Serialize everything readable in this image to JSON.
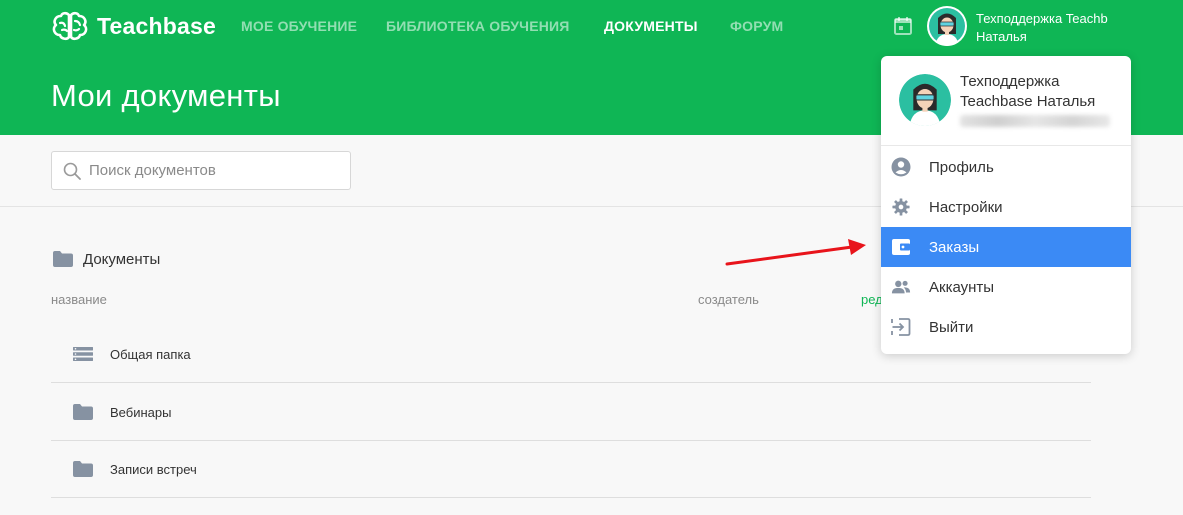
{
  "brand": {
    "name": "Teachbase",
    "primary_color": "#0fb655"
  },
  "nav": {
    "items": [
      {
        "label": "МОЕ ОБУЧЕНИЕ",
        "active": false
      },
      {
        "label": "БИБЛИОТЕКА ОБУЧЕНИЯ",
        "active": false
      },
      {
        "label": "ДОКУМЕНТЫ",
        "active": true
      },
      {
        "label": "ФОРУМ",
        "active": false
      }
    ]
  },
  "user": {
    "line1": "Техподдержка Teachb",
    "line2": "Наталья",
    "full_name": "Техподдержка Teachbase Наталья"
  },
  "page": {
    "title": "Мои документы"
  },
  "search": {
    "placeholder": "Поиск документов"
  },
  "breadcrumb": {
    "label": "Документы"
  },
  "table": {
    "columns": {
      "name": "название",
      "creator": "создатель",
      "edited": "ред"
    },
    "rows": [
      {
        "name": "Общая папка",
        "icon": "stack-icon"
      },
      {
        "name": "Вебинары",
        "icon": "folder-icon"
      },
      {
        "name": "Записи встреч",
        "icon": "folder-icon"
      }
    ]
  },
  "dropdown": {
    "items": [
      {
        "label": "Профиль",
        "icon": "user-circle-icon",
        "active": false
      },
      {
        "label": "Настройки",
        "icon": "gear-icon",
        "active": false
      },
      {
        "label": "Заказы",
        "icon": "wallet-icon",
        "active": true,
        "highlight_color": "#3b8af5"
      },
      {
        "label": "Аккаунты",
        "icon": "users-icon",
        "active": false
      },
      {
        "label": "Выйти",
        "icon": "logout-icon",
        "active": false
      }
    ]
  },
  "annotation": {
    "arrow_color": "#e8141b"
  }
}
